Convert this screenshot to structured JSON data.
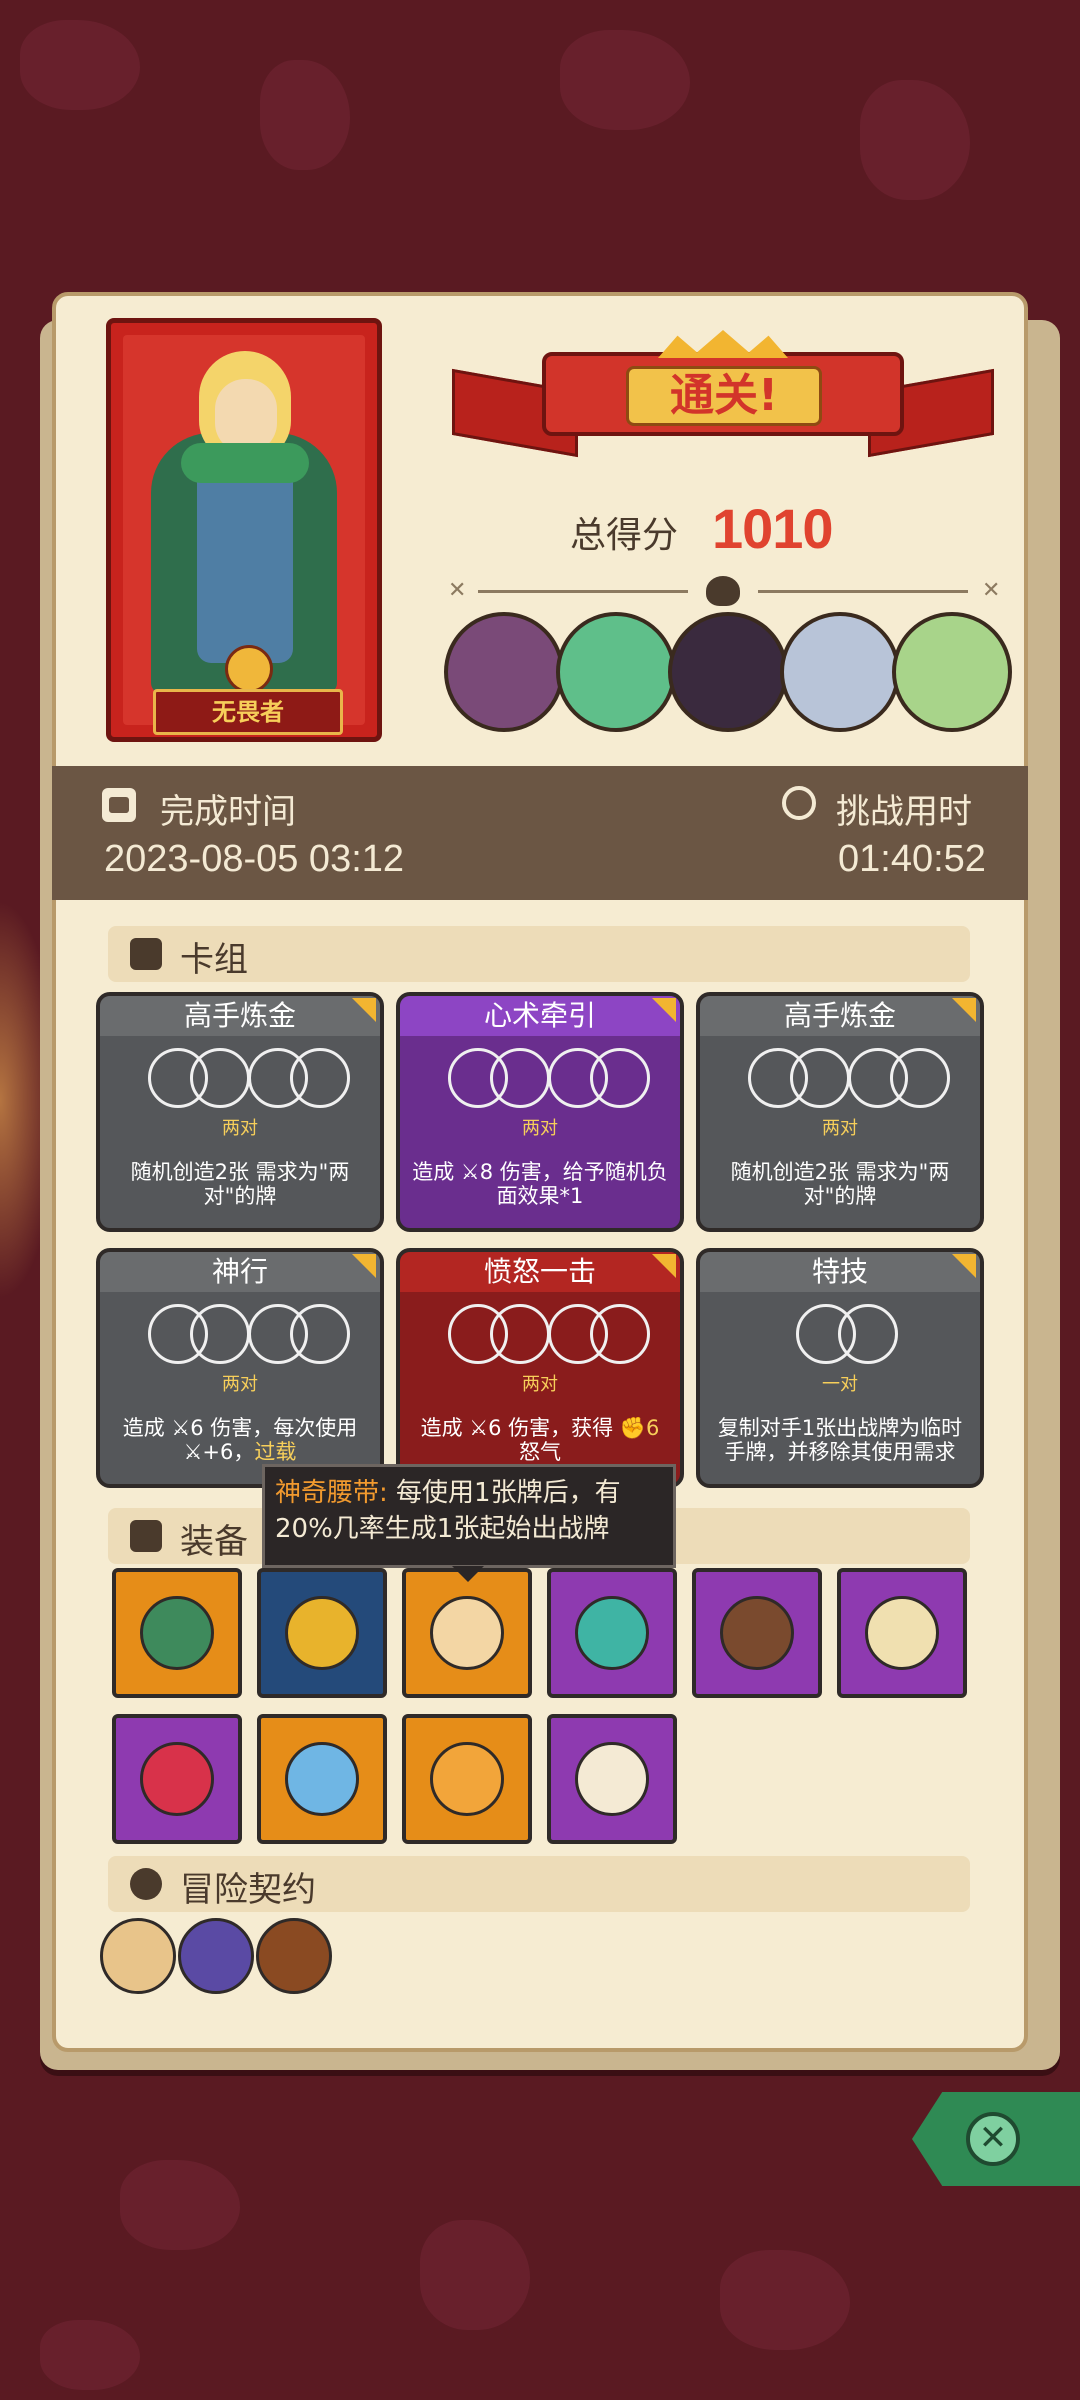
{
  "hero": {
    "name": "无畏者"
  },
  "banner": {
    "title": "通关!"
  },
  "score": {
    "label": "总得分",
    "value": "1010"
  },
  "bosses": [
    {
      "name": "stone-golem-boss"
    },
    {
      "name": "dragon-boss"
    },
    {
      "name": "shadow-beast-boss"
    },
    {
      "name": "armored-knight-boss"
    },
    {
      "name": "forest-elf-boss"
    }
  ],
  "stats": {
    "completion_label": "完成时间",
    "completion_value": "2023-08-05 03:12",
    "duration_label": "挑战用时",
    "duration_value": "01:40:52"
  },
  "sections": {
    "deck": "卡组",
    "equipment": "装备",
    "contract": "冒险契约"
  },
  "cards": [
    {
      "title": "高手炼金",
      "pair": "两对",
      "desc": "随机创造2张 需求为\"两对\"的牌",
      "style": "gray"
    },
    {
      "title": "心术牵引",
      "pair": "两对",
      "desc": "造成 ⚔8 伤害，给予随机负面效果*1",
      "style": "purple"
    },
    {
      "title": "高手炼金",
      "pair": "两对",
      "desc": "随机创造2张 需求为\"两对\"的牌",
      "style": "gray"
    },
    {
      "title": "神行",
      "pair": "两对",
      "desc_a": "造成 ⚔6 伤害，每次使用⚔+6，",
      "desc_b": "过载",
      "style": "gray"
    },
    {
      "title": "愤怒一击",
      "pair": "两对",
      "desc_a": "造成 ⚔6 伤害，获得 ",
      "desc_b": "✊6",
      "desc_c": "怒气",
      "style": "red"
    },
    {
      "title": "特技",
      "pair": "一对",
      "desc": "复制对手1张出战牌为临时手牌，并移除其使用需求",
      "style": "gray"
    }
  ],
  "tooltip": {
    "name": "神奇腰带:",
    "text": " 每使用1张牌后，有20%几率生成1张起始出战牌"
  },
  "equipment": [
    {
      "icon": "turtle-shell-icon",
      "bg": "orange",
      "color": "#3e8a5c"
    },
    {
      "icon": "golden-helmet-icon",
      "bg": "navy",
      "color": "#e8b32c"
    },
    {
      "icon": "magic-belt-icon",
      "bg": "orange",
      "color": "#f3d6a4"
    },
    {
      "icon": "demon-mask-icon",
      "bg": "vio",
      "color": "#3fb4a4"
    },
    {
      "icon": "button-shield-icon",
      "bg": "vio",
      "color": "#7a4a2e"
    },
    {
      "icon": "hand-mirror-icon",
      "bg": "vio",
      "color": "#f0e0b0"
    },
    {
      "icon": "ruby-necklace-icon",
      "bg": "vio",
      "color": "#d8324a"
    },
    {
      "icon": "serrated-blade-icon",
      "bg": "orange",
      "color": "#6fb6e4"
    },
    {
      "icon": "knit-sweater-icon",
      "bg": "orange",
      "color": "#f2a53a"
    },
    {
      "icon": "spiked-dice-icon",
      "bg": "vio",
      "color": "#f4ead4"
    }
  ],
  "contracts": [
    {
      "icon": "scroll-contract-icon",
      "color": "#e8c48a"
    },
    {
      "icon": "mushroom-contract-icon",
      "color": "#5a4aa4"
    },
    {
      "icon": "pipe-contract-icon",
      "color": "#8a4a22"
    }
  ],
  "colors": {
    "accent": "#e0432f",
    "panel": "#f6ecd2",
    "close": "#2f8a54"
  }
}
